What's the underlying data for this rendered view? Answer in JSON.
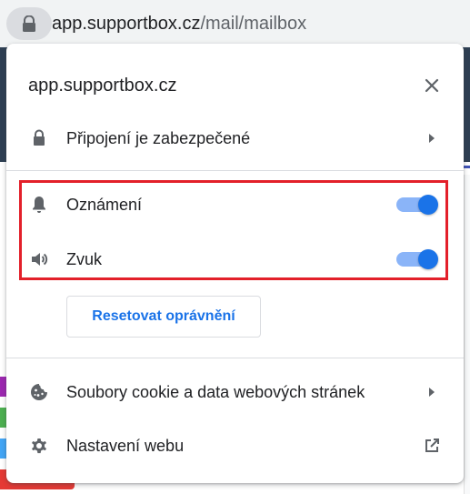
{
  "browser": {
    "url_domain": "app.supportbox.cz",
    "url_path": "/mail/mailbox",
    "lock_icon": "lock-icon"
  },
  "popup": {
    "title": "app.supportbox.cz",
    "close_icon": "close-icon",
    "connection": {
      "label": "Připojení je zabezpečené",
      "icon": "lock-icon"
    },
    "permissions": [
      {
        "label": "Oznámení",
        "icon": "bell-icon",
        "enabled": true
      },
      {
        "label": "Zvuk",
        "icon": "speaker-icon",
        "enabled": true
      }
    ],
    "reset_label": "Resetovat oprávnění",
    "cookies": {
      "label": "Soubory cookie a data webových stránek",
      "icon": "cookie-icon"
    },
    "site_settings": {
      "label": "Nastavení webu",
      "icon": "gear-icon"
    }
  },
  "colors": {
    "accent": "#1a73e8",
    "highlight_border": "#e3202a",
    "toggle_track": "#8ab4f8"
  }
}
